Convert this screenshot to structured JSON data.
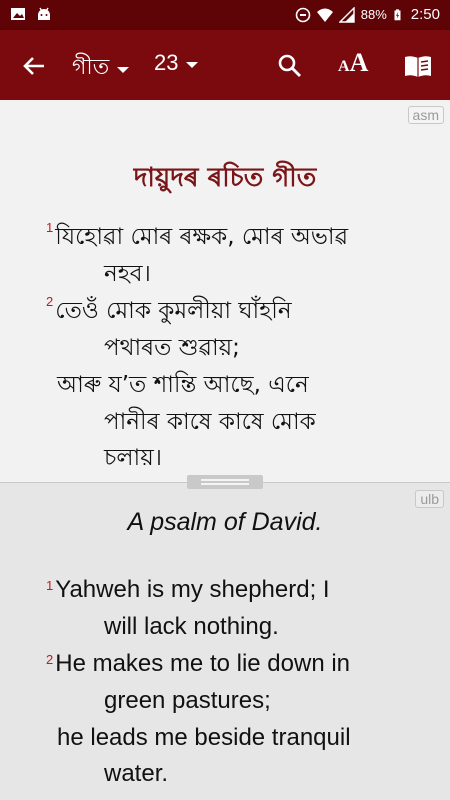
{
  "status_bar": {
    "battery": "88%",
    "time": "2:50"
  },
  "app_bar": {
    "book": "গীত",
    "chapter": "23",
    "colors": {
      "bar": "#7a0a0e",
      "status": "#5e0306"
    }
  },
  "pane_top": {
    "tag": "asm",
    "heading": "দায়ুদৰ ৰচিত গীত",
    "verses": [
      {
        "num": "1",
        "lines": [
          "যিহোৱা মোৰ ৰক্ষক, মোৰ অভাৱ",
          "নহব।"
        ]
      },
      {
        "num": "2",
        "lines": [
          "তেওঁ মোক কুমলীয়া ঘাঁহনি",
          "পথাৰত শুৱায়;"
        ]
      },
      {
        "num": "",
        "lines": [
          "আৰু য’ত শান্তি আছে, এনে",
          "পানীৰ কাষে কাষে মোক",
          "চলায়।"
        ]
      }
    ]
  },
  "pane_bottom": {
    "tag": "ulb",
    "heading": "A psalm of David.",
    "verses": [
      {
        "num": "1",
        "lines": [
          "Yahweh is my shepherd; I",
          "will lack nothing."
        ]
      },
      {
        "num": "2",
        "lines": [
          "He makes me to lie down in",
          "green pastures;"
        ]
      },
      {
        "num": "",
        "lines": [
          "he leads me beside tranquil",
          "water."
        ]
      }
    ]
  }
}
